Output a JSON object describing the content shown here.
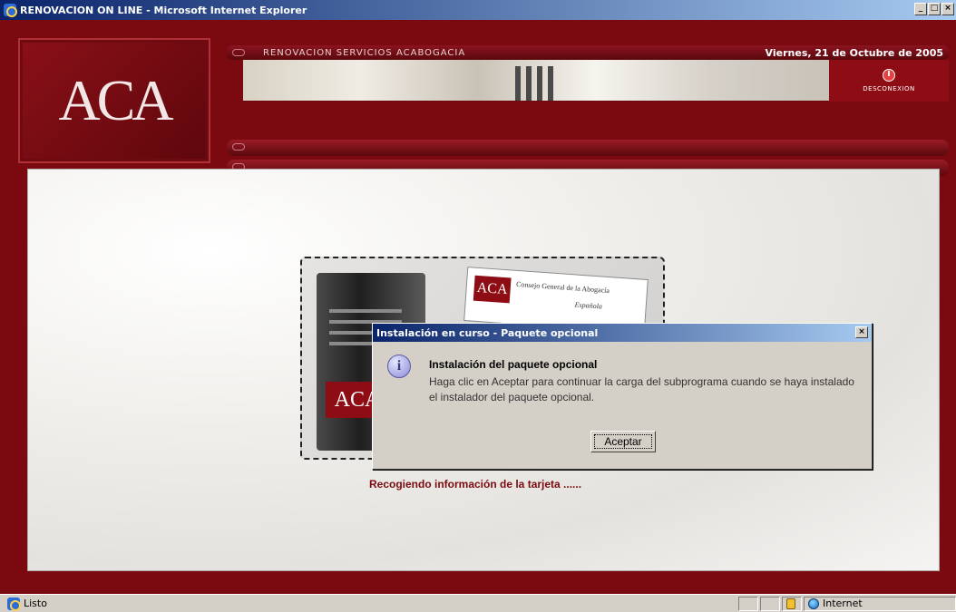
{
  "window": {
    "title": "RENOVACION ON LINE - Microsoft Internet Explorer",
    "min_glyph": "_",
    "max_glyph": "□",
    "close_glyph": "×"
  },
  "header": {
    "logo": "ACA",
    "banner_title": "RENOVACION SERVICIOS ACABOGACIA",
    "date": "Viernes, 21 de Octubre de 2005",
    "disconnect_label": "DESCONEXION"
  },
  "splash": {
    "server_logo": "ACA",
    "card_logo": "ACA",
    "card_title": "Consejo General de la Abogacía",
    "card_subtitle": "Española"
  },
  "main": {
    "status_message": "Recogiendo información de la tarjeta ......"
  },
  "dialog": {
    "title": "Instalación en curso - Paquete opcional",
    "close_glyph": "×",
    "icon_glyph": "i",
    "heading": "Instalación del paquete opcional",
    "body": "Haga clic en Aceptar para continuar la carga del subprograma cuando se haya instalado el instalador del paquete opcional.",
    "accept_label": "Aceptar"
  },
  "statusbar": {
    "status_text": "Listo",
    "zone": "Internet"
  },
  "colors": {
    "brand_red": "#7a0a10",
    "titlebar_blue": "#0a246a",
    "dialog_gray": "#d4d0c8"
  }
}
